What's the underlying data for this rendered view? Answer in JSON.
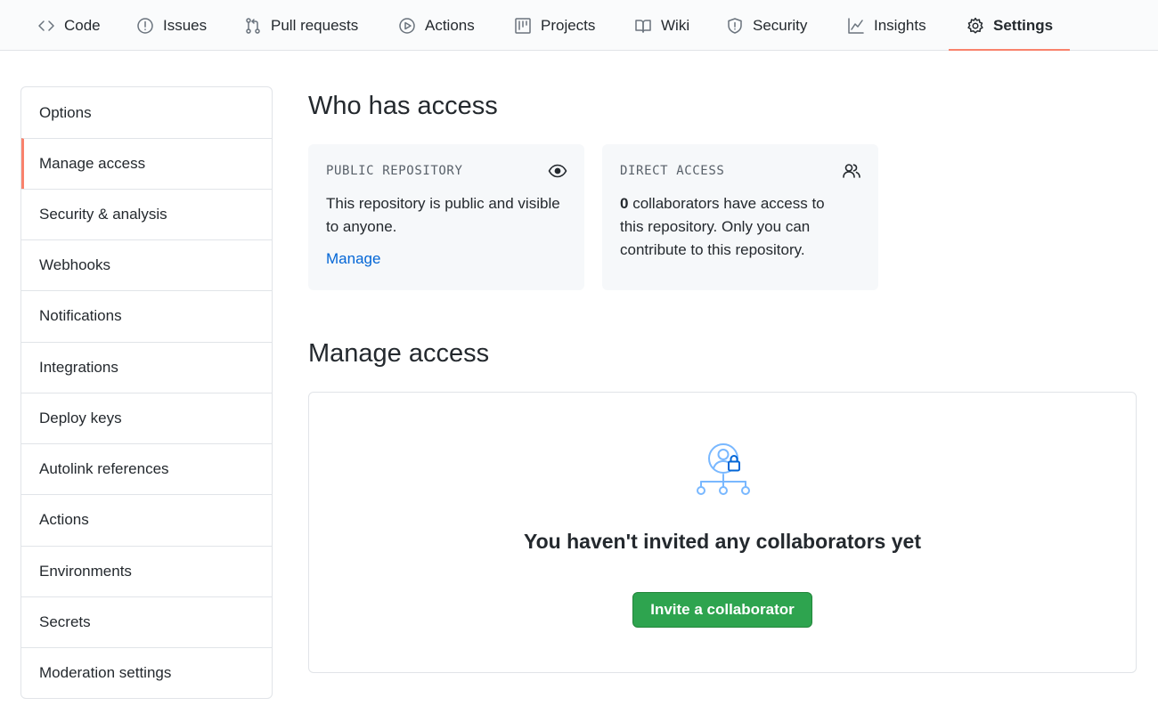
{
  "tabs": [
    {
      "label": "Code",
      "icon": "code-icon"
    },
    {
      "label": "Issues",
      "icon": "issue-icon"
    },
    {
      "label": "Pull requests",
      "icon": "pull-request-icon"
    },
    {
      "label": "Actions",
      "icon": "play-icon"
    },
    {
      "label": "Projects",
      "icon": "project-icon"
    },
    {
      "label": "Wiki",
      "icon": "book-icon"
    },
    {
      "label": "Security",
      "icon": "shield-icon"
    },
    {
      "label": "Insights",
      "icon": "graph-icon"
    },
    {
      "label": "Settings",
      "icon": "gear-icon",
      "active": true
    }
  ],
  "sidebar": {
    "items": [
      {
        "label": "Options"
      },
      {
        "label": "Manage access",
        "active": true
      },
      {
        "label": "Security & analysis"
      },
      {
        "label": "Webhooks"
      },
      {
        "label": "Notifications"
      },
      {
        "label": "Integrations"
      },
      {
        "label": "Deploy keys"
      },
      {
        "label": "Autolink references"
      },
      {
        "label": "Actions"
      },
      {
        "label": "Environments"
      },
      {
        "label": "Secrets"
      },
      {
        "label": "Moderation settings"
      }
    ]
  },
  "who_has_access": {
    "title": "Who has access",
    "public_card": {
      "label": "PUBLIC REPOSITORY",
      "icon": "eye-icon",
      "text": "This repository is public and visible to anyone.",
      "link": "Manage"
    },
    "direct_card": {
      "label": "DIRECT ACCESS",
      "icon": "people-icon",
      "count": "0",
      "text": " collaborators have access to this repository. Only you can contribute to this repository."
    }
  },
  "manage_access": {
    "title": "Manage access",
    "empty_icon": "collaborator-lock-icon",
    "empty_title": "You haven't invited any collaborators yet",
    "invite_button": "Invite a collaborator"
  },
  "colors": {
    "accent_underline": "#f9826c",
    "link": "#0366d6",
    "primary_button": "#2ea44f",
    "illustration_blue": "#79b8ff"
  }
}
